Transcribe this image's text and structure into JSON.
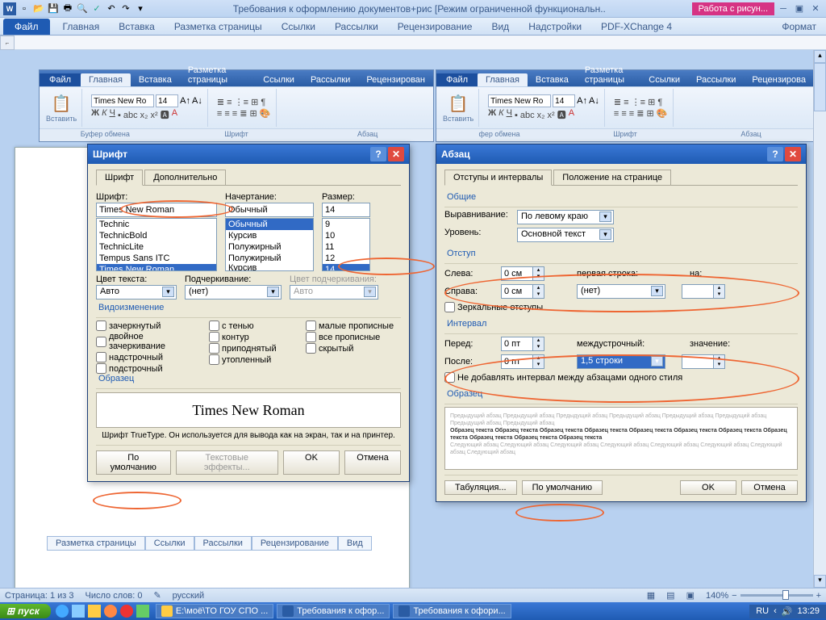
{
  "qat": {
    "title": "Требования к оформлению документов+рис [Режим ограниченной функциональн..",
    "pink": "Работа с рисун..."
  },
  "main_tabs": {
    "file": "Файл",
    "items": [
      "Главная",
      "Вставка",
      "Разметка страницы",
      "Ссылки",
      "Рассылки",
      "Рецензирование",
      "Вид",
      "Надстройки",
      "PDF-XChange 4"
    ],
    "format": "Формат"
  },
  "mini": {
    "file": "Файл",
    "tabs": [
      "Главная",
      "Вставка",
      "Разметка страницы",
      "Ссылки",
      "Рассылки",
      "Рецензирован"
    ],
    "tabs2": [
      "Главная",
      "Вставка",
      "Разметка страницы",
      "Ссылки",
      "Рассылки",
      "Рецензирова"
    ],
    "paste": "Вставить",
    "font_name": "Times New Ro",
    "font_size": "14",
    "groups": [
      "Буфер обмена",
      "Шрифт",
      "Абзац"
    ],
    "groups2": [
      "фер обмена",
      "Шрифт",
      "Абзац"
    ]
  },
  "font_dialog": {
    "title": "Шрифт",
    "tab1": "Шрифт",
    "tab2": "Дополнительно",
    "lbl_font": "Шрифт:",
    "lbl_style": "Начертание:",
    "lbl_size": "Размер:",
    "font_val": "Times New Roman",
    "font_list": [
      "Technic",
      "TechnicBold",
      "TechnicLite",
      "Tempus Sans ITC",
      "Times New Roman"
    ],
    "style_val": "Обычный",
    "style_list": [
      "Обычный",
      "Курсив",
      "Полужирный",
      "Полужирный Курсив"
    ],
    "size_val": "14",
    "size_list": [
      "9",
      "10",
      "11",
      "12",
      "14"
    ],
    "lbl_color": "Цвет текста:",
    "color_val": "Авто",
    "lbl_under": "Подчеркивание:",
    "under_val": "(нет)",
    "lbl_ucolor": "Цвет подчеркивания:",
    "ucolor_val": "Авто",
    "effects_lbl": "Видоизменение",
    "fx": [
      "зачеркнутый",
      "двойное зачеркивание",
      "надстрочный",
      "подстрочный",
      "с тенью",
      "контур",
      "приподнятый",
      "утопленный",
      "малые прописные",
      "все прописные",
      "скрытый"
    ],
    "sample_lbl": "Образец",
    "sample_text": "Times New Roman",
    "truetype": "Шрифт TrueType. Он используется для вывода как на экран, так и на принтер.",
    "default": "По умолчанию",
    "texteff": "Текстовые эффекты...",
    "ok": "OK",
    "cancel": "Отмена"
  },
  "para_dialog": {
    "title": "Абзац",
    "tab1": "Отступы и интервалы",
    "tab2": "Положение на странице",
    "section_general": "Общие",
    "lbl_align": "Выравнивание:",
    "align_val": "По левому краю",
    "lbl_level": "Уровень:",
    "level_val": "Основной текст",
    "section_indent": "Отступ",
    "lbl_left": "Слева:",
    "left_val": "0 см",
    "lbl_right": "Справа:",
    "right_val": "0 см",
    "lbl_first": "первая строка:",
    "first_val": "(нет)",
    "lbl_by": "на:",
    "mirror": "Зеркальные отступы",
    "section_spacing": "Интервал",
    "lbl_before": "Перед:",
    "before_val": "0 пт",
    "lbl_after": "После:",
    "after_val": "0 пт",
    "lbl_line": "междустрочный:",
    "line_val": "1,5 строки",
    "lbl_val": "значение:",
    "nospace": "Не добавлять интервал между абзацами одного стиля",
    "sample_lbl": "Образец",
    "tabs_btn": "Табуляция...",
    "default": "По умолчанию",
    "ok": "OK",
    "cancel": "Отмена"
  },
  "bottom_tabs": [
    "Разметка страницы",
    "Ссылки",
    "Рассылки",
    "Рецензирование",
    "Вид"
  ],
  "status": {
    "page": "Страница: 1 из 3",
    "words": "Число слов: 0",
    "lang": "русский",
    "zoom": "140%"
  },
  "taskbar": {
    "start": "пуск",
    "tasks": [
      "E:\\моё\\ТО ГОУ СПО ...",
      "Требования к офор...",
      "Требования к офори..."
    ],
    "lang": "RU",
    "time": "13:29"
  }
}
